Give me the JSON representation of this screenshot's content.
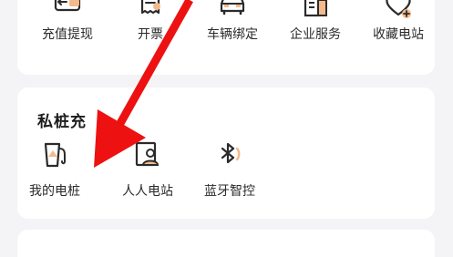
{
  "services": {
    "items": [
      {
        "label": "充值提现",
        "icon": "wallet-icon"
      },
      {
        "label": "开票",
        "icon": "invoice-icon"
      },
      {
        "label": "车辆绑定",
        "icon": "car-icon"
      },
      {
        "label": "企业服务",
        "icon": "building-icon"
      },
      {
        "label": "收藏电站",
        "icon": "heart-plus-icon"
      }
    ]
  },
  "private_pile": {
    "title": "私桩充",
    "items": [
      {
        "label": "我的电桩",
        "icon": "charging-pile-icon"
      },
      {
        "label": "人人电站",
        "icon": "person-station-icon"
      },
      {
        "label": "蓝牙智控",
        "icon": "bluetooth-icon"
      }
    ]
  },
  "colors": {
    "accent": "#f5b98a",
    "icon_stroke": "#2b2b2b",
    "annotation_arrow": "#ee1111"
  }
}
